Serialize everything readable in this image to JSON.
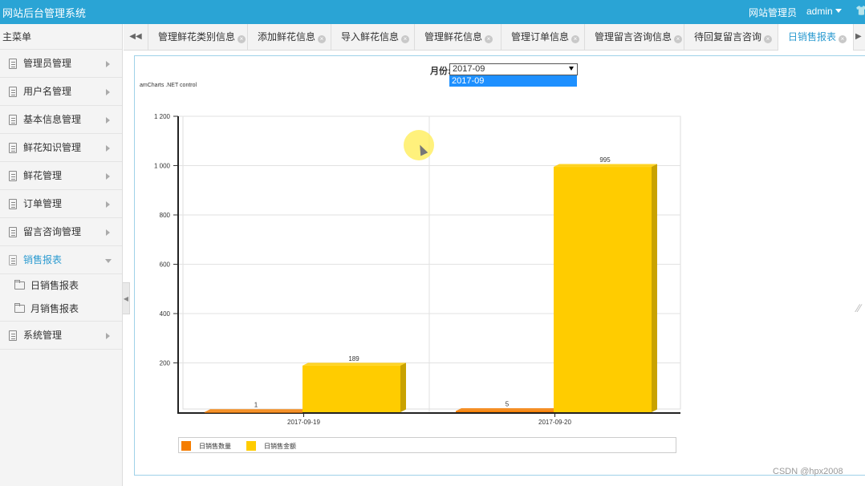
{
  "header": {
    "brand": "网站后台管理系统",
    "role": "网站管理员",
    "user": "admin"
  },
  "sidebar": {
    "title": "主菜单",
    "items": [
      {
        "label": "管理员管理",
        "name": "sidebar-item-admin-management"
      },
      {
        "label": "用户名管理",
        "name": "sidebar-item-username-management"
      },
      {
        "label": "基本信息管理",
        "name": "sidebar-item-basic-info"
      },
      {
        "label": "鲜花知识管理",
        "name": "sidebar-item-flower-knowledge"
      },
      {
        "label": "鲜花管理",
        "name": "sidebar-item-flower-management"
      },
      {
        "label": "订单管理",
        "name": "sidebar-item-order-management"
      },
      {
        "label": "留言咨询管理",
        "name": "sidebar-item-message-management"
      },
      {
        "label": "销售报表",
        "name": "sidebar-item-sales-report"
      },
      {
        "label": "系统管理",
        "name": "sidebar-item-system-management"
      }
    ],
    "sub_items": [
      {
        "label": "日销售报表"
      },
      {
        "label": "月销售报表"
      }
    ]
  },
  "tabs": [
    {
      "label": "管理鲜花类别信息"
    },
    {
      "label": "添加鲜花信息"
    },
    {
      "label": "导入鲜花信息"
    },
    {
      "label": "管理鲜花信息"
    },
    {
      "label": "管理订单信息"
    },
    {
      "label": "管理留言咨询信息"
    },
    {
      "label": "待回复留言咨询"
    },
    {
      "label": "日销售报表"
    }
  ],
  "filter": {
    "month_label": "月份:",
    "month_value": "2017-09",
    "month_options": [
      "2017-09"
    ]
  },
  "credit": "amCharts .NET control",
  "chart_data": {
    "type": "bar",
    "categories": [
      "2017-09-19",
      "2017-09-20"
    ],
    "series": [
      {
        "name": "日销售数量",
        "values": [
          1,
          5
        ],
        "color": "#f57d00"
      },
      {
        "name": "日销售金额",
        "values": [
          189,
          995
        ],
        "color": "#ffcc00"
      }
    ],
    "ylim": [
      0,
      1200
    ],
    "yticks": [
      200,
      400,
      600,
      800,
      1000,
      1200
    ],
    "ytick_labels": [
      "200",
      "400",
      "600",
      "800",
      "1 000",
      "1 200"
    ],
    "grid": true,
    "legend_position": "bottom",
    "style": "3d-column"
  },
  "watermark": "CSDN @hpx2008"
}
